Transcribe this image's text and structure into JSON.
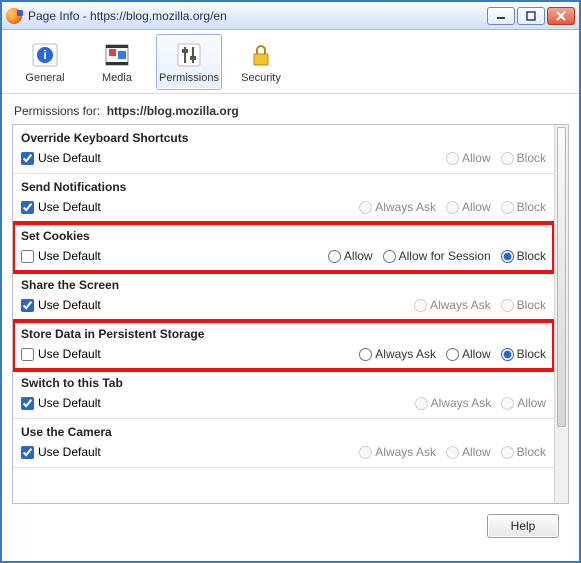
{
  "window": {
    "title": "Page Info - https://blog.mozilla.org/en"
  },
  "toolbar": {
    "items": [
      {
        "label": "General"
      },
      {
        "label": "Media"
      },
      {
        "label": "Permissions"
      },
      {
        "label": "Security"
      }
    ]
  },
  "permissions_for_label": "Permissions for:",
  "permissions_for_url": "https://blog.mozilla.org",
  "use_default_label": "Use Default",
  "option_labels": {
    "allow": "Allow",
    "block": "Block",
    "always_ask": "Always Ask",
    "allow_for_session": "Allow for Session"
  },
  "permissions": [
    {
      "title": "Override Keyboard Shortcuts",
      "use_default": true,
      "highlight": false,
      "options": [
        {
          "key": "allow",
          "selected": false,
          "enabled": false
        },
        {
          "key": "block",
          "selected": false,
          "enabled": false
        }
      ]
    },
    {
      "title": "Send Notifications",
      "use_default": true,
      "highlight": false,
      "options": [
        {
          "key": "always_ask",
          "selected": false,
          "enabled": false
        },
        {
          "key": "allow",
          "selected": false,
          "enabled": false
        },
        {
          "key": "block",
          "selected": false,
          "enabled": false
        }
      ]
    },
    {
      "title": "Set Cookies",
      "use_default": false,
      "highlight": true,
      "options": [
        {
          "key": "allow",
          "selected": false,
          "enabled": true
        },
        {
          "key": "allow_for_session",
          "selected": false,
          "enabled": true
        },
        {
          "key": "block",
          "selected": true,
          "enabled": true
        }
      ]
    },
    {
      "title": "Share the Screen",
      "use_default": true,
      "highlight": false,
      "options": [
        {
          "key": "always_ask",
          "selected": false,
          "enabled": false
        },
        {
          "key": "block",
          "selected": false,
          "enabled": false
        }
      ]
    },
    {
      "title": "Store Data in Persistent Storage",
      "use_default": false,
      "highlight": true,
      "options": [
        {
          "key": "always_ask",
          "selected": false,
          "enabled": true
        },
        {
          "key": "allow",
          "selected": false,
          "enabled": true
        },
        {
          "key": "block",
          "selected": true,
          "enabled": true
        }
      ]
    },
    {
      "title": "Switch to this Tab",
      "use_default": true,
      "highlight": false,
      "options": [
        {
          "key": "always_ask",
          "selected": false,
          "enabled": false
        },
        {
          "key": "allow",
          "selected": false,
          "enabled": false
        }
      ]
    },
    {
      "title": "Use the Camera",
      "use_default": true,
      "highlight": false,
      "options": [
        {
          "key": "always_ask",
          "selected": false,
          "enabled": false
        },
        {
          "key": "allow",
          "selected": false,
          "enabled": false
        },
        {
          "key": "block",
          "selected": false,
          "enabled": false
        }
      ]
    }
  ],
  "footer": {
    "help_label": "Help"
  }
}
